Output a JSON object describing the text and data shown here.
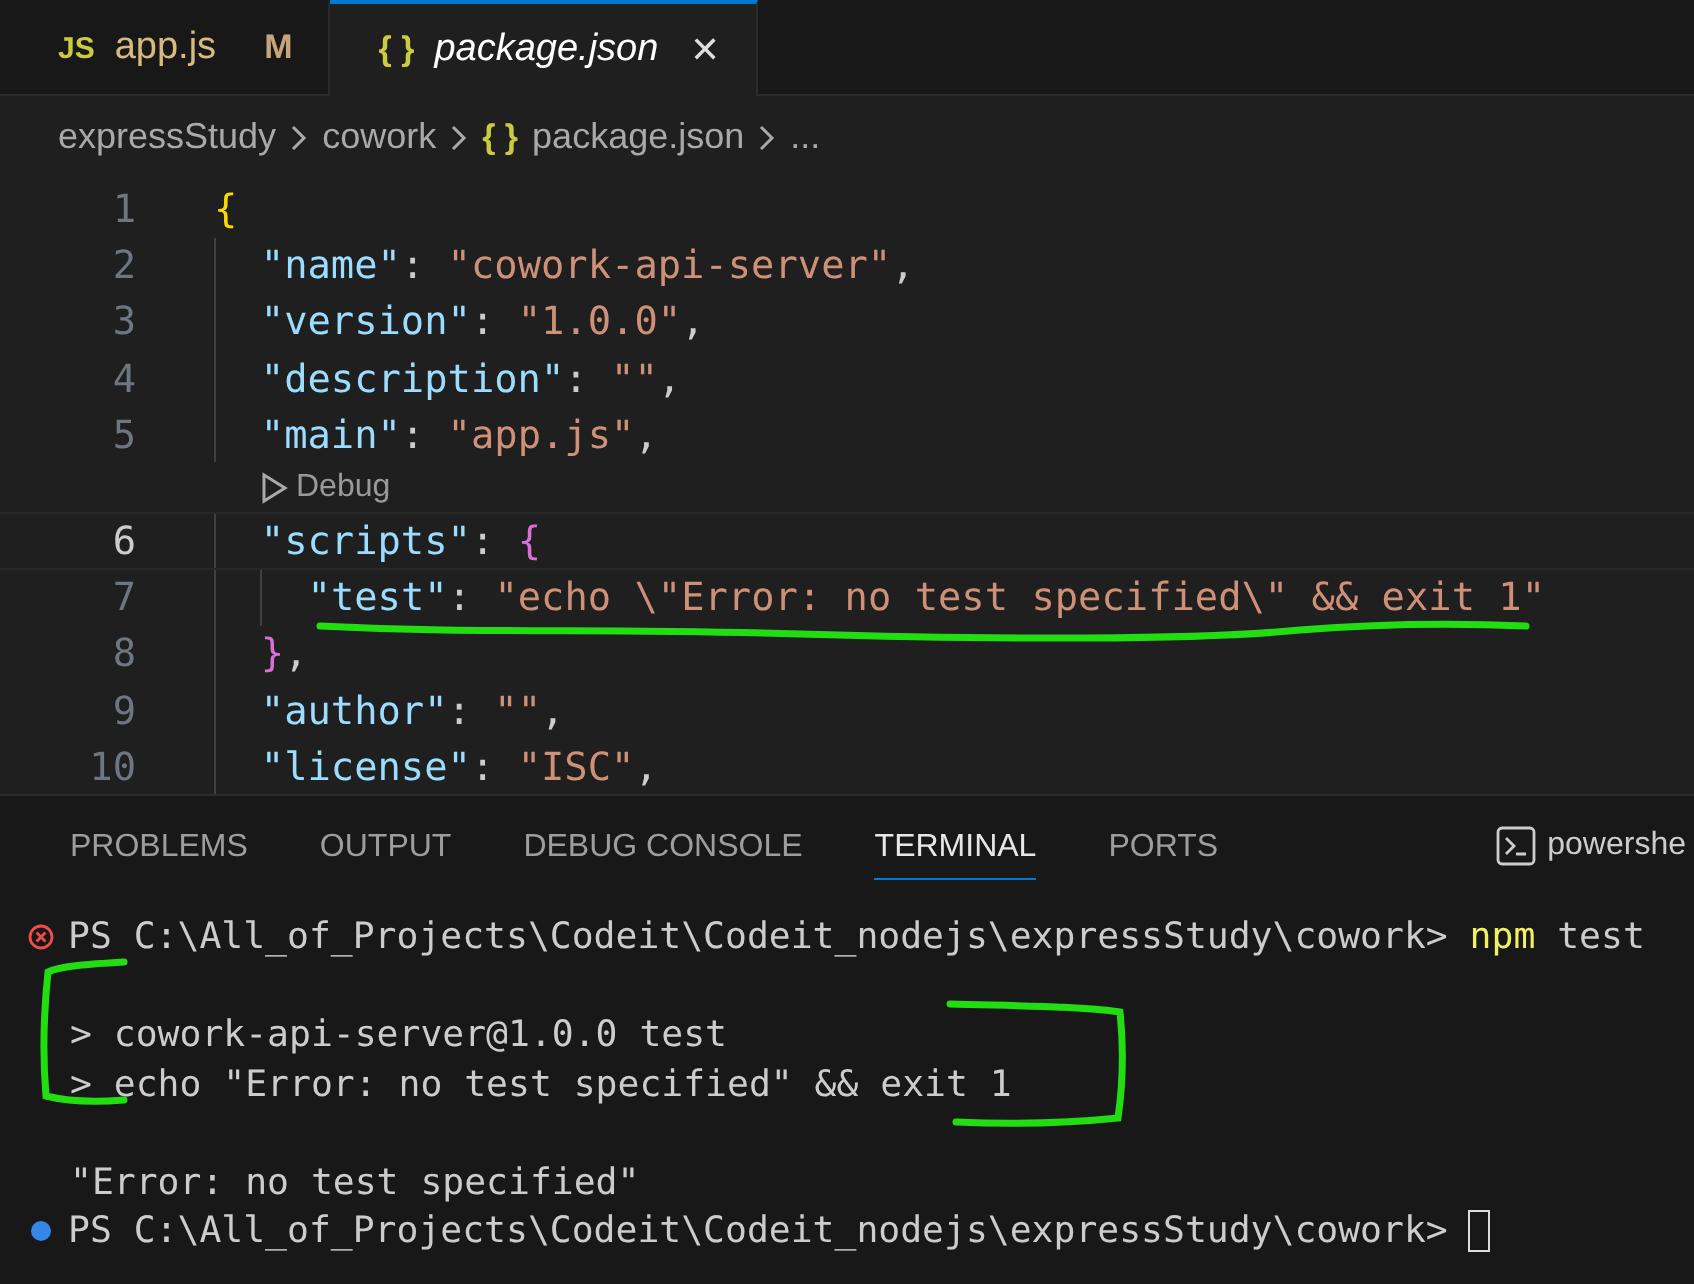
{
  "tabs": [
    {
      "label": "app.js",
      "icon": "JS",
      "badge": "M",
      "selected": false,
      "preview": false
    },
    {
      "label": "package.json",
      "icon": "{ }",
      "close": "✕",
      "selected": true,
      "preview": true
    }
  ],
  "breadcrumb": [
    {
      "label": "expressStudy"
    },
    {
      "label": "cowork"
    },
    {
      "label": "package.json",
      "icon": "{ }"
    },
    {
      "label": "..."
    }
  ],
  "editor": {
    "lines": [
      {
        "number": "1",
        "current": false,
        "tokens": [
          {
            "kind": "brace",
            "text": "{"
          }
        ]
      },
      {
        "number": "2",
        "current": false,
        "tokens": [
          {
            "kind": "key",
            "text": "  \"name\""
          },
          {
            "kind": "punct",
            "text": ": "
          },
          {
            "kind": "string",
            "text": "\"cowork-api-server\""
          },
          {
            "kind": "punct",
            "text": ","
          }
        ]
      },
      {
        "number": "3",
        "current": false,
        "tokens": [
          {
            "kind": "key",
            "text": "  \"version\""
          },
          {
            "kind": "punct",
            "text": ": "
          },
          {
            "kind": "string",
            "text": "\"1.0.0\""
          },
          {
            "kind": "punct",
            "text": ","
          }
        ]
      },
      {
        "number": "4",
        "current": false,
        "tokens": [
          {
            "kind": "key",
            "text": "  \"description\""
          },
          {
            "kind": "punct",
            "text": ": "
          },
          {
            "kind": "string",
            "text": "\"\""
          },
          {
            "kind": "punct",
            "text": ","
          }
        ]
      },
      {
        "number": "5",
        "current": false,
        "tokens": [
          {
            "kind": "key",
            "text": "  \"main\""
          },
          {
            "kind": "punct",
            "text": ": "
          },
          {
            "kind": "string",
            "text": "\"app.js\""
          },
          {
            "kind": "punct",
            "text": ","
          }
        ],
        "codelens": "Debug"
      },
      {
        "number": "6",
        "current": true,
        "tokens": [
          {
            "kind": "key",
            "text": "  \"scripts\""
          },
          {
            "kind": "punct",
            "text": ": "
          },
          {
            "kind": "subbrace",
            "text": "{"
          }
        ]
      },
      {
        "number": "7",
        "current": false,
        "tokens": [
          {
            "kind": "key",
            "text": "    \"test\""
          },
          {
            "kind": "punct",
            "text": ": "
          },
          {
            "kind": "string",
            "text": "\"echo \\\"Error: no test specified\\\" && exit 1\""
          }
        ]
      },
      {
        "number": "8",
        "current": false,
        "tokens": [
          {
            "kind": "subbrace",
            "text": "  }"
          },
          {
            "kind": "punct",
            "text": ","
          }
        ]
      },
      {
        "number": "9",
        "current": false,
        "tokens": [
          {
            "kind": "key",
            "text": "  \"author\""
          },
          {
            "kind": "punct",
            "text": ": "
          },
          {
            "kind": "string",
            "text": "\"\""
          },
          {
            "kind": "punct",
            "text": ","
          }
        ]
      },
      {
        "number": "10",
        "current": false,
        "tokens": [
          {
            "kind": "key",
            "text": "  \"license\""
          },
          {
            "kind": "punct",
            "text": ": "
          },
          {
            "kind": "string",
            "text": "\"ISC\""
          },
          {
            "kind": "punct",
            "text": ","
          }
        ]
      }
    ]
  },
  "panel": {
    "tabs": [
      {
        "label": "PROBLEMS",
        "selected": false
      },
      {
        "label": "OUTPUT",
        "selected": false
      },
      {
        "label": "DEBUG CONSOLE",
        "selected": false
      },
      {
        "label": "TERMINAL",
        "selected": true
      },
      {
        "label": "PORTS",
        "selected": false
      }
    ],
    "shell": "powershe",
    "terminal": [
      {
        "kind": "prompt",
        "failed": true,
        "prompt": "PS C:\\All_of_Projects\\Codeit\\Codeit_nodejs\\expressStudy\\cowork>",
        "command": "npm",
        "args": "test",
        "cursor": false
      },
      {
        "kind": "blank"
      },
      {
        "kind": "output",
        "text": "> cowork-api-server@1.0.0 test"
      },
      {
        "kind": "output",
        "text": "> echo \"Error: no test specified\" && exit 1"
      },
      {
        "kind": "blank"
      },
      {
        "kind": "output",
        "text": "\"Error: no test specified\""
      },
      {
        "kind": "prompt",
        "failed": false,
        "prompt": "PS C:\\All_of_Projects\\Codeit\\Codeit_nodejs\\expressStudy\\cowork>",
        "cursor": true
      }
    ]
  }
}
